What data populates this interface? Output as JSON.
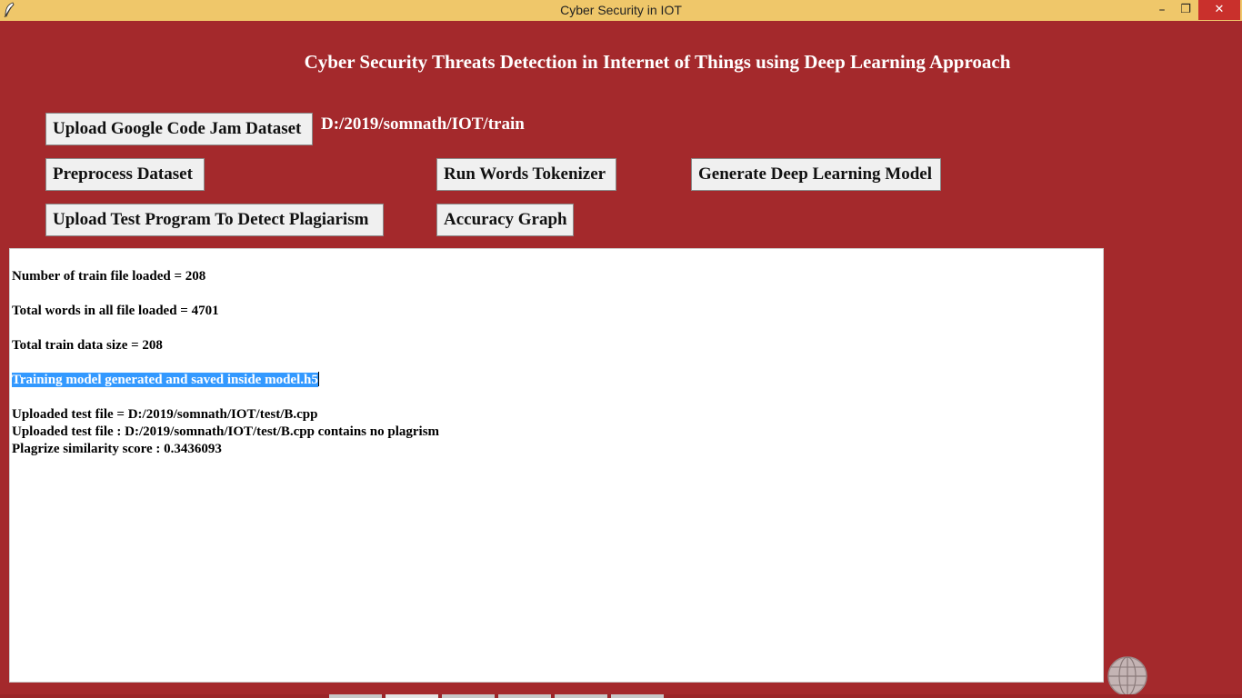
{
  "window": {
    "title": "Cyber Security in IOT",
    "minimize": "–",
    "maximize": "❐",
    "close": "✕"
  },
  "app": {
    "heading": "Cyber Security Threats Detection in Internet of Things using Deep Learning Approach"
  },
  "buttons": {
    "upload_dataset": "Upload Google Code Jam Dataset",
    "preprocess": "Preprocess Dataset",
    "run_tokenizer": "Run Words Tokenizer",
    "generate_model": "Generate Deep Learning Model",
    "upload_test": "Upload Test Program To Detect Plagiarism",
    "accuracy_graph": "Accuracy Graph"
  },
  "dataset_path": "D:/2019/somnath/IOT/train",
  "output": {
    "lines": [
      "Number of train file loaded = 208",
      "Total words in all file loaded = 4701",
      "Total train data size = 208",
      "Training model generated and saved inside model.h5",
      "Uploaded test file = D:/2019/somnath/IOT/test/B.cpp",
      "Uploaded test file : D:/2019/somnath/IOT/test/B.cpp contains no plagrism",
      "Plagrize similarity score : 0.3436093"
    ]
  },
  "colors": {
    "background": "#a4292c",
    "titlebar": "#efc76a",
    "selection": "#3399ff"
  }
}
